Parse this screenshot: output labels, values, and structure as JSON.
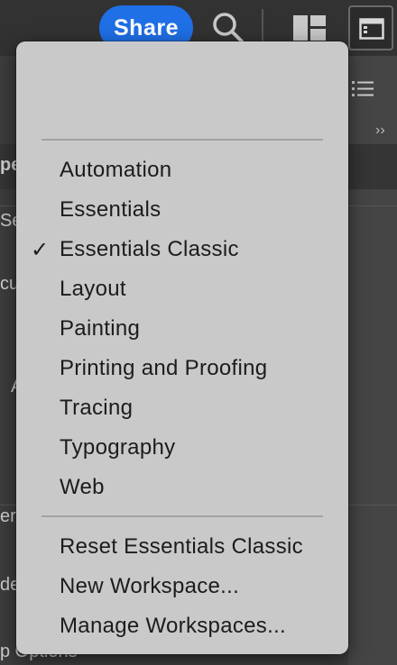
{
  "topbar": {
    "share_label": "Share",
    "search_icon": "search-icon",
    "arrange_icon": "arrange-documents-icon",
    "workspace_icon": "workspace-switcher-icon",
    "share_color": "#1f6fe6"
  },
  "background": {
    "fragments": [
      "pe",
      "Se",
      "cu",
      "A",
      "er",
      "de",
      "p Options"
    ]
  },
  "menu": {
    "workspaces": [
      {
        "label": "Automation",
        "checked": false
      },
      {
        "label": "Essentials",
        "checked": false
      },
      {
        "label": "Essentials Classic",
        "checked": true
      },
      {
        "label": "Layout",
        "checked": false
      },
      {
        "label": "Painting",
        "checked": false
      },
      {
        "label": "Printing and Proofing",
        "checked": false
      },
      {
        "label": "Tracing",
        "checked": false
      },
      {
        "label": "Typography",
        "checked": false
      },
      {
        "label": "Web",
        "checked": false
      }
    ],
    "check_mark": "✓",
    "actions": [
      {
        "label": "Reset Essentials Classic"
      },
      {
        "label": "New Workspace..."
      },
      {
        "label": "Manage Workspaces..."
      }
    ]
  }
}
